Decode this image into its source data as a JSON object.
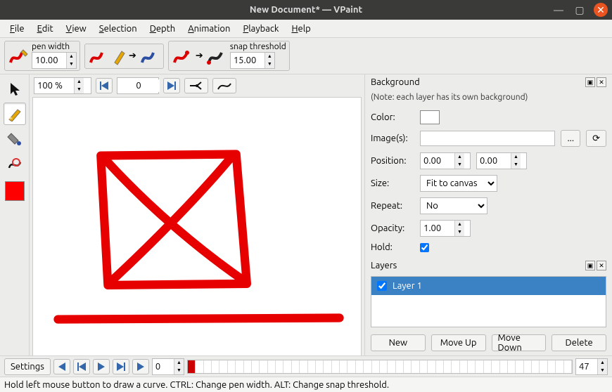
{
  "window": {
    "title": "New Document* — VPaint"
  },
  "menu": [
    "File",
    "Edit",
    "View",
    "Selection",
    "Depth",
    "Animation",
    "Playback",
    "Help"
  ],
  "toolbar": {
    "pen_width_label": "pen width",
    "pen_width_value": "10.00",
    "snap_label": "snap threshold",
    "snap_value": "15.00"
  },
  "canvasbar": {
    "zoom_value": "100 %",
    "frame_value": "0"
  },
  "background": {
    "title": "Background",
    "note": "(Note: each layer has its own background)",
    "labels": {
      "color": "Color:",
      "images": "Image(s):",
      "position": "Position:",
      "size": "Size:",
      "repeat": "Repeat:",
      "opacity": "Opacity:",
      "hold": "Hold:"
    },
    "images_value": "",
    "pos_x": "0.00",
    "pos_y": "0.00",
    "size_value": "Fit to canvas",
    "repeat_value": "No",
    "opacity_value": "1.00",
    "hold_checked": true,
    "browse": "...",
    "refresh": "⟳"
  },
  "layers": {
    "title": "Layers",
    "items": [
      {
        "name": "Layer 1",
        "visible": true
      }
    ],
    "buttons": {
      "new": "New",
      "up": "Move Up",
      "down": "Move Down",
      "del": "Delete"
    }
  },
  "timeline": {
    "settings": "Settings",
    "current": "0",
    "end": "47"
  },
  "status": "Hold left mouse button to draw a curve. CTRL: Change pen width. ALT: Change snap threshold.",
  "colors": {
    "accent": "#3a82c4",
    "draw": "#e60000"
  }
}
